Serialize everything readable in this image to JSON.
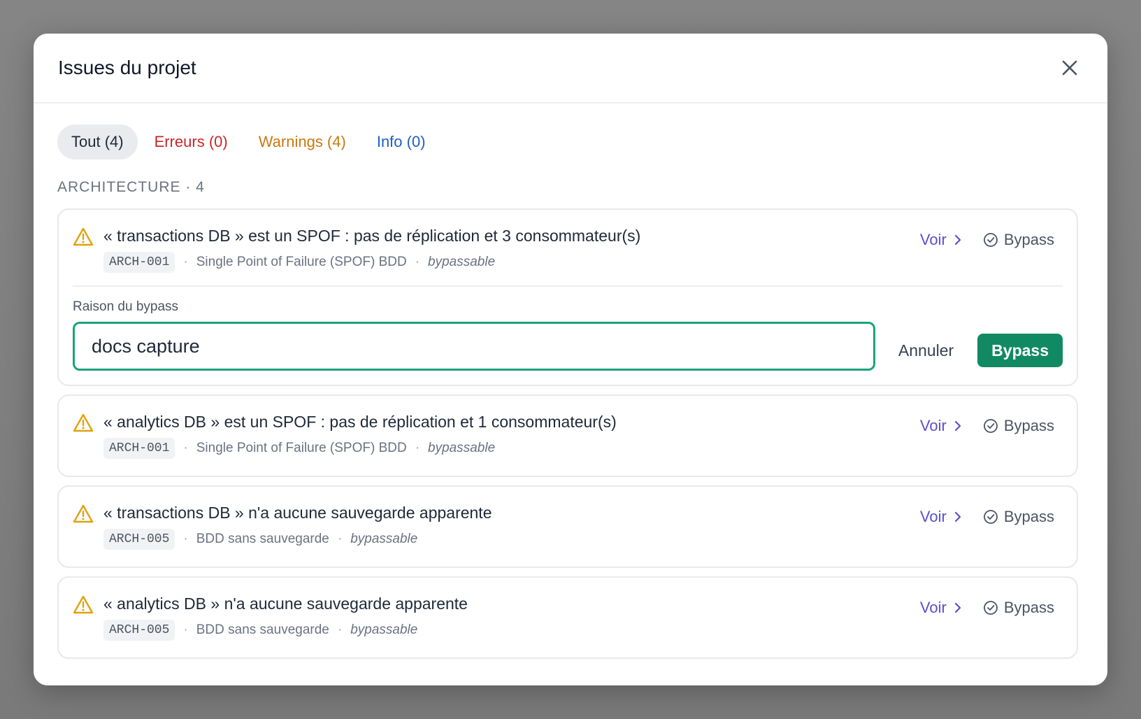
{
  "modal": {
    "title": "Issues du projet"
  },
  "tabs": [
    {
      "label": "Tout (4)",
      "active": true
    },
    {
      "label": "Erreurs (0)"
    },
    {
      "label": "Warnings (4)"
    },
    {
      "label": "Info (0)"
    }
  ],
  "section": {
    "title": "ARCHITECTURE · 4"
  },
  "issues": [
    {
      "title": "« transactions DB » est un SPOF : pas de réplication et 3 consommateur(s)",
      "code": "ARCH-001",
      "rule": "Single Point of Failure (SPOF) BDD",
      "tag": "bypassable",
      "voir": "Voir",
      "bypass": "Bypass"
    },
    {
      "title": "« analytics DB » est un SPOF : pas de réplication et 1 consommateur(s)",
      "code": "ARCH-001",
      "rule": "Single Point of Failure (SPOF) BDD",
      "tag": "bypassable",
      "voir": "Voir",
      "bypass": "Bypass"
    },
    {
      "title": "« transactions DB » n'a aucune sauvegarde apparente",
      "code": "ARCH-005",
      "rule": "BDD sans sauvegarde",
      "tag": "bypassable",
      "voir": "Voir",
      "bypass": "Bypass"
    },
    {
      "title": "« analytics DB » n'a aucune sauvegarde apparente",
      "code": "ARCH-005",
      "rule": "BDD sans sauvegarde",
      "tag": "bypassable",
      "voir": "Voir",
      "bypass": "Bypass"
    }
  ],
  "bypass_form": {
    "label": "Raison du bypass",
    "value": "docs capture",
    "cancel": "Annuler",
    "submit": "Bypass"
  },
  "colors": {
    "accent_green": "#118a63",
    "input_border": "#1aa37a",
    "warning": "#e0a10e",
    "error": "#c62828",
    "info": "#1f5fc4",
    "link": "#5b4fcf"
  },
  "icons": {
    "close": "close-icon",
    "warning": "warning-triangle-icon",
    "chevron": "chevron-right-icon",
    "check": "check-circle-icon"
  }
}
